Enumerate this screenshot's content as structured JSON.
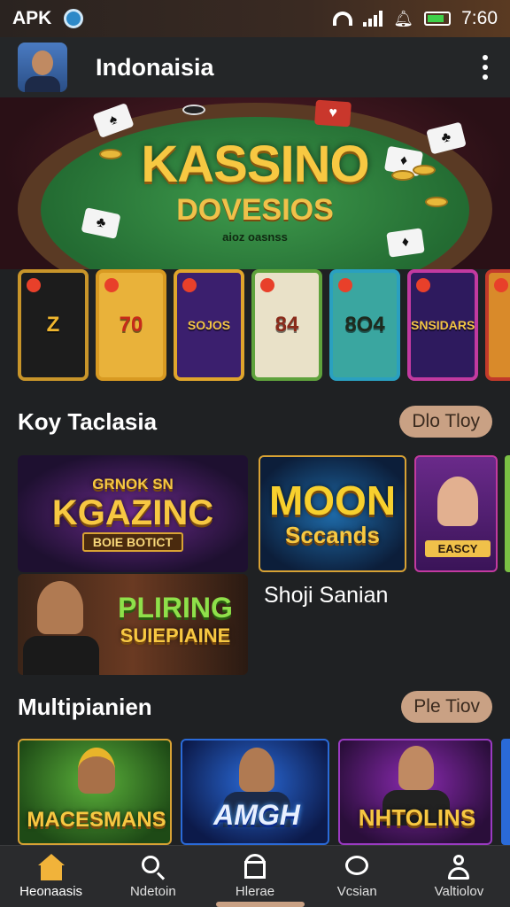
{
  "status_bar": {
    "app_label": "APK",
    "time": "7:60",
    "icons": [
      "status-app-icon",
      "wifi-icon",
      "signal-icon",
      "silent-icon",
      "battery-icon"
    ]
  },
  "header": {
    "title": "Indonaisia",
    "menu_icon": "more-vert-icon"
  },
  "banner": {
    "title": "KASSINO",
    "subtitle": "DOVESIOS",
    "caption": "aioz oasnss"
  },
  "tiles": [
    {
      "label": "Z",
      "bg": "#1c1c1c",
      "border": "#c8952a",
      "color": "#f0b62e"
    },
    {
      "label": "70",
      "bg": "#e9b23a",
      "border": "#d89a22",
      "color": "#c62a1a"
    },
    {
      "label": "SOJOS",
      "bg": "#3b1f6e",
      "border": "#e0a52c",
      "color": "#f2c443"
    },
    {
      "label": "84",
      "bg": "#e9e1c8",
      "border": "#5fa23c",
      "color": "#8a2a1a"
    },
    {
      "label": "8O4",
      "bg": "#3aa6a0",
      "border": "#2aa0c0",
      "color": "#1e2a1e"
    },
    {
      "label": "SNSIDARS",
      "bg": "#2e1a5e",
      "border": "#c23aa0",
      "color": "#f2c443"
    },
    {
      "label": "",
      "bg": "#d98a2a",
      "border": "#c23a2a",
      "color": "#ffffff"
    }
  ],
  "section1": {
    "title": "Koy Taclasia",
    "button": "Dlo Tloy",
    "cards": [
      {
        "top_text": "GRNOK SN",
        "main_text": "KGAZINC",
        "sub_text": "BOIE BOTICT"
      },
      {
        "main_text": "PLIRING",
        "sub_text": "SUIEPIAINE"
      },
      {
        "main_text": "MOON",
        "sub_text": "Sccands"
      },
      {
        "main_text": "EASCY"
      }
    ],
    "caption": "Shoji Sanian"
  },
  "section2": {
    "title": "Multipianien",
    "button": "Ple Tiov",
    "cards": [
      {
        "main_text": "MACESMANS"
      },
      {
        "main_text": "AMGH"
      },
      {
        "main_text": "NHTOLINS"
      }
    ]
  },
  "bottom_nav": [
    {
      "label": "Heonaasis",
      "icon": "home-icon"
    },
    {
      "label": "Ndetoin",
      "icon": "search-icon"
    },
    {
      "label": "Hlerae",
      "icon": "store-icon"
    },
    {
      "label": "Vcsian",
      "icon": "chat-icon"
    },
    {
      "label": "Valtiolov",
      "icon": "profile-icon"
    }
  ],
  "colors": {
    "accent": "#c9a184",
    "background": "#1f2123",
    "gold": "#f7c842"
  }
}
